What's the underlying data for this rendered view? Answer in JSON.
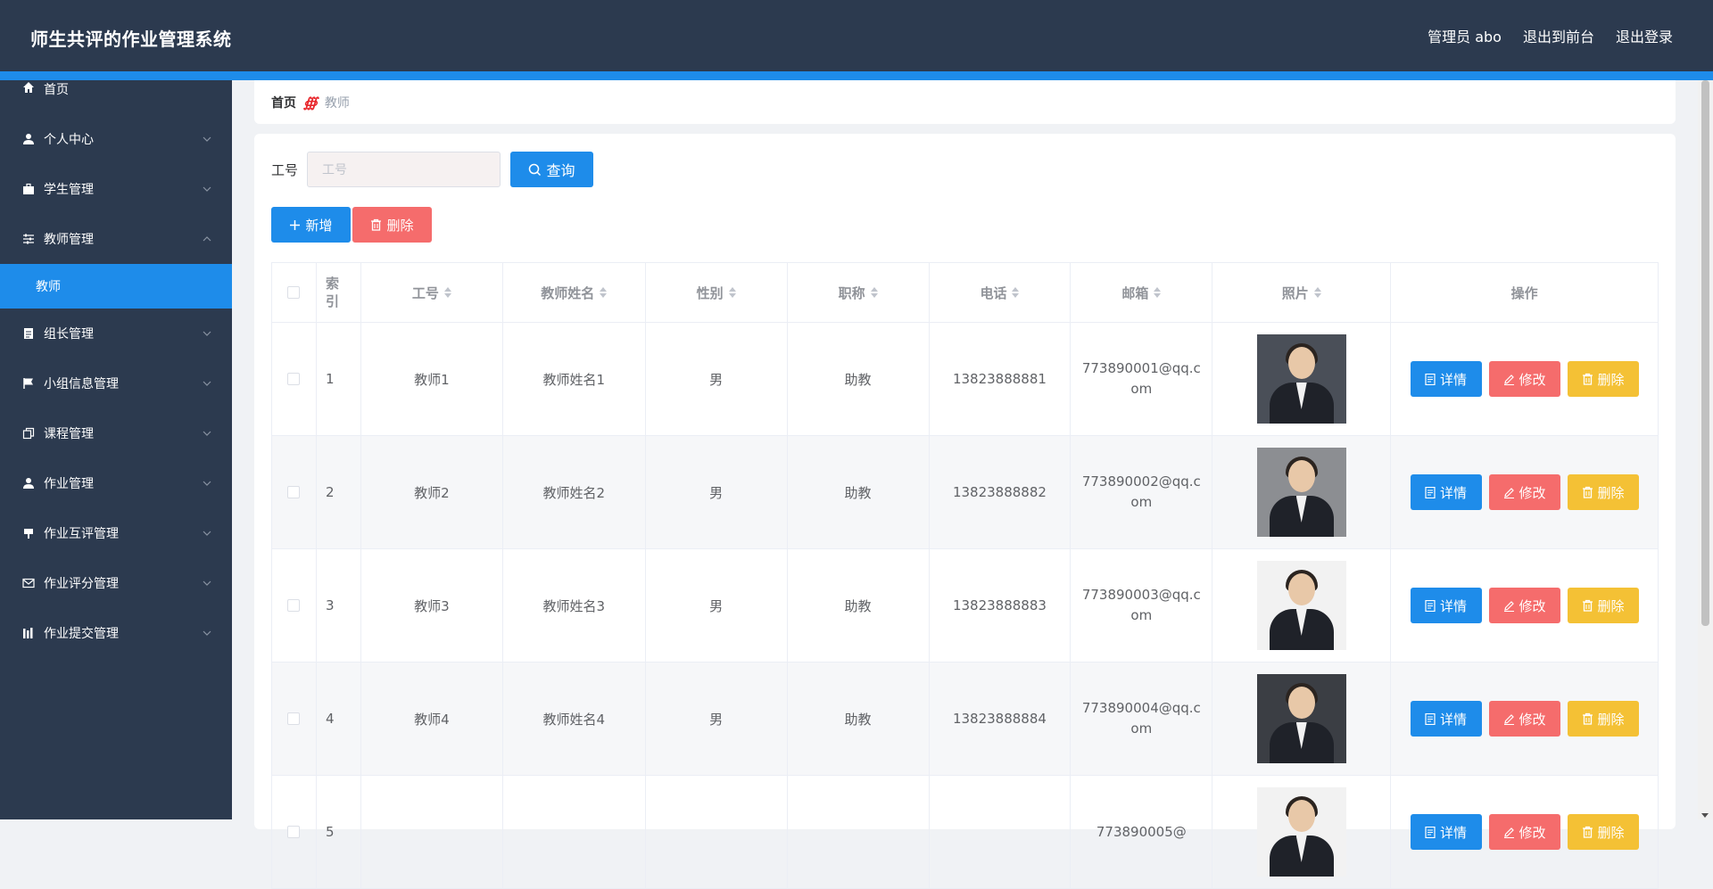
{
  "header": {
    "title": "师生共评的作业管理系统",
    "admin": "管理员 abo",
    "to_front": "退出到前台",
    "logout": "退出登录"
  },
  "sidebar": {
    "items": [
      {
        "label": "首页",
        "icon": "home-icon"
      },
      {
        "label": "个人中心",
        "icon": "user-icon"
      },
      {
        "label": "学生管理",
        "icon": "briefcase-icon"
      },
      {
        "label": "教师管理",
        "icon": "sliders-icon",
        "expanded": true
      },
      {
        "label": "组长管理",
        "icon": "document-icon"
      },
      {
        "label": "小组信息管理",
        "icon": "flag-icon"
      },
      {
        "label": "课程管理",
        "icon": "copy-icon"
      },
      {
        "label": "作业管理",
        "icon": "user-icon"
      },
      {
        "label": "作业互评管理",
        "icon": "stamp-icon"
      },
      {
        "label": "作业评分管理",
        "icon": "mail-icon"
      },
      {
        "label": "作业提交管理",
        "icon": "bars-icon"
      }
    ],
    "active_subitem": "教师"
  },
  "breadcrumb": {
    "home": "首页",
    "separator": "∰",
    "current": "教师"
  },
  "search": {
    "label": "工号",
    "placeholder": "工号",
    "query_label": "查询"
  },
  "actions": {
    "add_label": "新增",
    "delete_label": "删除"
  },
  "table": {
    "columns": [
      "索引",
      "工号",
      "教师姓名",
      "性别",
      "职称",
      "电话",
      "邮箱",
      "照片",
      "操作"
    ],
    "rows": [
      {
        "index": "1",
        "id": "教师1",
        "name": "教师姓名1",
        "gender": "男",
        "title": "助教",
        "phone": "13823888881",
        "email": "773890001@qq.com"
      },
      {
        "index": "2",
        "id": "教师2",
        "name": "教师姓名2",
        "gender": "男",
        "title": "助教",
        "phone": "13823888882",
        "email": "773890002@qq.com"
      },
      {
        "index": "3",
        "id": "教师3",
        "name": "教师姓名3",
        "gender": "男",
        "title": "助教",
        "phone": "13823888883",
        "email": "773890003@qq.com"
      },
      {
        "index": "4",
        "id": "教师4",
        "name": "教师姓名4",
        "gender": "男",
        "title": "助教",
        "phone": "13823888884",
        "email": "773890004@qq.com"
      },
      {
        "index": "5",
        "id": "",
        "name": "",
        "gender": "",
        "title": "",
        "phone": "",
        "email": "773890005@"
      }
    ],
    "row_actions": {
      "detail": "详情",
      "edit": "修改",
      "delete": "删除"
    }
  },
  "colors": {
    "header_bg": "#2c3a4f",
    "accent": "#1e8cea",
    "danger": "#f56c6c",
    "warning": "#f4c135"
  }
}
